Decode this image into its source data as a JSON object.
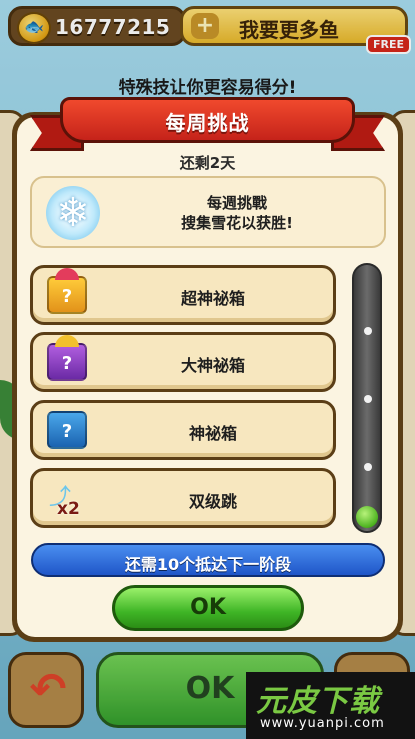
{
  "header": {
    "coin_count": "16777215",
    "more_fish_label": "我要更多鱼",
    "free_badge": "FREE",
    "tagline": "特殊技让你更容易得分!"
  },
  "dialog": {
    "title": "每周挑战",
    "remaining": "还剩2天",
    "challenge": {
      "title": "每週挑戰",
      "description": "搜集雪花以获胜!"
    },
    "rewards": [
      {
        "label": "超神祕箱",
        "icon": "super-mystery-box-icon"
      },
      {
        "label": "大神祕箱",
        "icon": "big-mystery-box-icon"
      },
      {
        "label": "神祕箱",
        "icon": "mystery-box-icon"
      },
      {
        "label": "双级跳",
        "icon": "double-jump-icon"
      }
    ],
    "progress_text": "还需10个抵达下一阶段",
    "progress_fraction": 0.0,
    "ok_label": "OK"
  },
  "background": {
    "ok_label": "OK"
  },
  "watermark": {
    "main": "元皮下载",
    "url": "www.yuanpi.com"
  },
  "colors": {
    "ribbon": "#c5231a",
    "progress_bar": "#1f55c8",
    "ok_button": "#3fb526",
    "panel_border": "#5b3e16"
  }
}
